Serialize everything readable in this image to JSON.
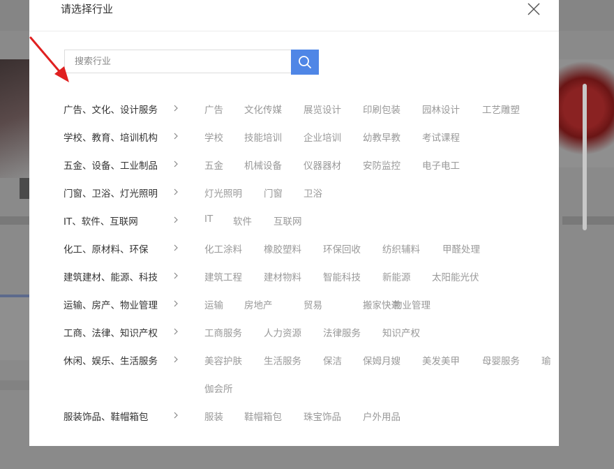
{
  "modal": {
    "title": "请选择行业",
    "search_placeholder": "搜索行业"
  },
  "categories": [
    {
      "name": "广告、文化、设计服务",
      "subs": [
        "广告",
        "文化传媒",
        "展览设计",
        "印刷包装",
        "园林设计",
        "工艺雕塑"
      ]
    },
    {
      "name": "学校、教育、培训机构",
      "subs": [
        "学校",
        "技能培训",
        "企业培训",
        "幼教早教",
        "考试课程"
      ]
    },
    {
      "name": "五金、设备、工业制品",
      "subs": [
        "五金",
        "机械设备",
        "仪器器材",
        "安防监控",
        "电子电工"
      ]
    },
    {
      "name": "门窗、卫浴、灯光照明",
      "subs": [
        "灯光照明",
        "门窗",
        "卫浴"
      ]
    },
    {
      "name": "IT、软件、互联网",
      "subs": [
        "IT",
        "软件",
        "互联网"
      ]
    },
    {
      "name": "化工、原材料、环保",
      "subs": [
        "化工涂料",
        "橡胶塑料",
        "环保回收",
        "纺织辅料",
        "甲醛处理"
      ]
    },
    {
      "name": "建筑建材、能源、科技",
      "subs": [
        "建筑工程",
        "建材物料",
        "智能科技",
        "新能源",
        "太阳能光伏"
      ]
    },
    {
      "name": "运输、房产、物业管理",
      "subs": [
        "运输",
        "房地产",
        "贸易",
        "搬家快递",
        "物业管理"
      ]
    },
    {
      "name": "工商、法律、知识产权",
      "subs": [
        "工商服务",
        "人力资源",
        "法律服务",
        "知识产权"
      ]
    },
    {
      "name": "休闲、娱乐、生活服务",
      "subs": [
        "美容护肤",
        "生活服务",
        "保洁",
        "保姆月嫂",
        "美发美甲",
        "母婴服务",
        "瑜",
        "伽会所"
      ]
    },
    {
      "name": "服装饰品、鞋帽箱包",
      "subs": [
        "服装",
        "鞋帽箱包",
        "珠宝饰品",
        "户外用品"
      ]
    }
  ],
  "colors": {
    "accent": "#4f86e6",
    "annotation_arrow": "#e02020",
    "overlay": "#7a7a7a"
  },
  "icons": {
    "close": "close-icon",
    "search": "search-icon",
    "chevron": "chevron-right-icon",
    "annotation": "arrow-annotation-icon"
  }
}
